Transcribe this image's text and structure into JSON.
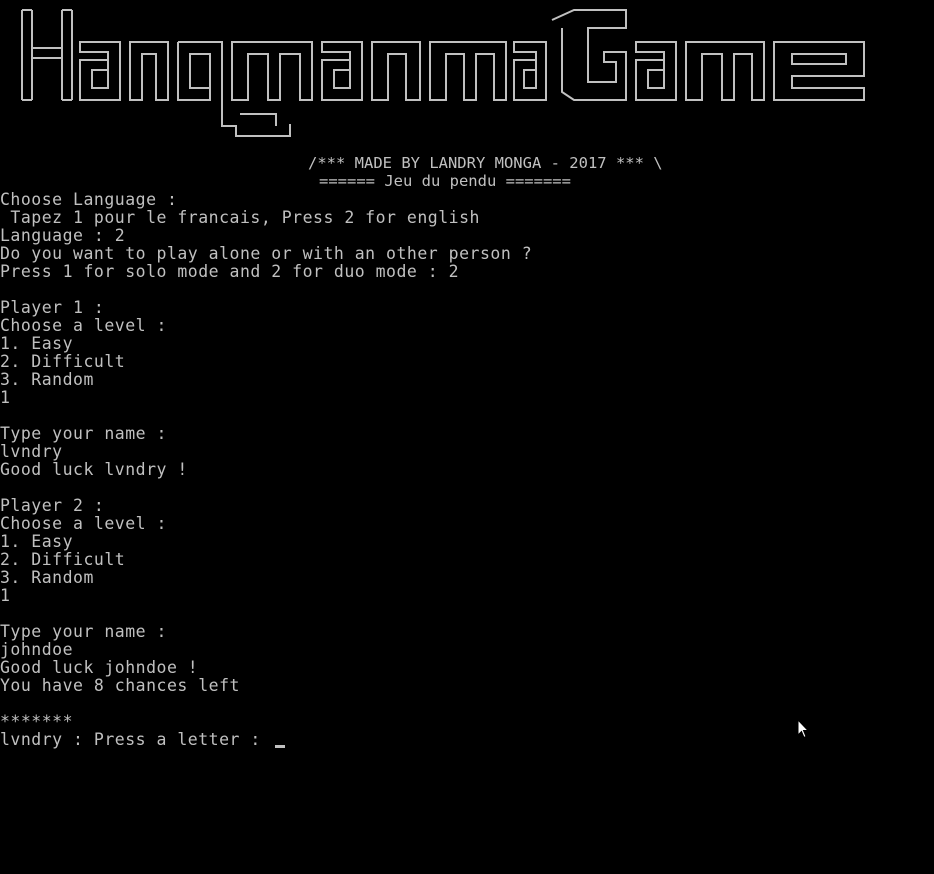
{
  "banner": {
    "title_art": "Hangman Game"
  },
  "credits": {
    "made_by": "/*** MADE BY LANDRY MONGA - 2017 *** \\",
    "subtitle": "====== Jeu du pendu ======="
  },
  "console": {
    "lines": [
      "Choose Language :",
      " Tapez 1 pour le francais, Press 2 for english",
      "Language : 2",
      "Do you want to play alone or with an other person ?",
      "Press 1 for solo mode and 2 for duo mode : 2",
      "",
      "Player 1 :",
      "Choose a level :",
      "1. Easy",
      "2. Difficult",
      "3. Random",
      "1",
      "",
      "Type your name :",
      "lvndry",
      "Good luck lvndry !",
      "",
      "Player 2 :",
      "Choose a level :",
      "1. Easy",
      "2. Difficult",
      "3. Random",
      "1",
      "",
      "Type your name :",
      "johndoe",
      "Good luck johndoe !",
      "You have 8 chances left",
      "",
      "*******"
    ],
    "prompt": "lvndry : Press a letter : "
  },
  "colors": {
    "background": "#000000",
    "text": "#c0c0c0"
  },
  "icons": {
    "pointer": "mouse-pointer-icon"
  }
}
